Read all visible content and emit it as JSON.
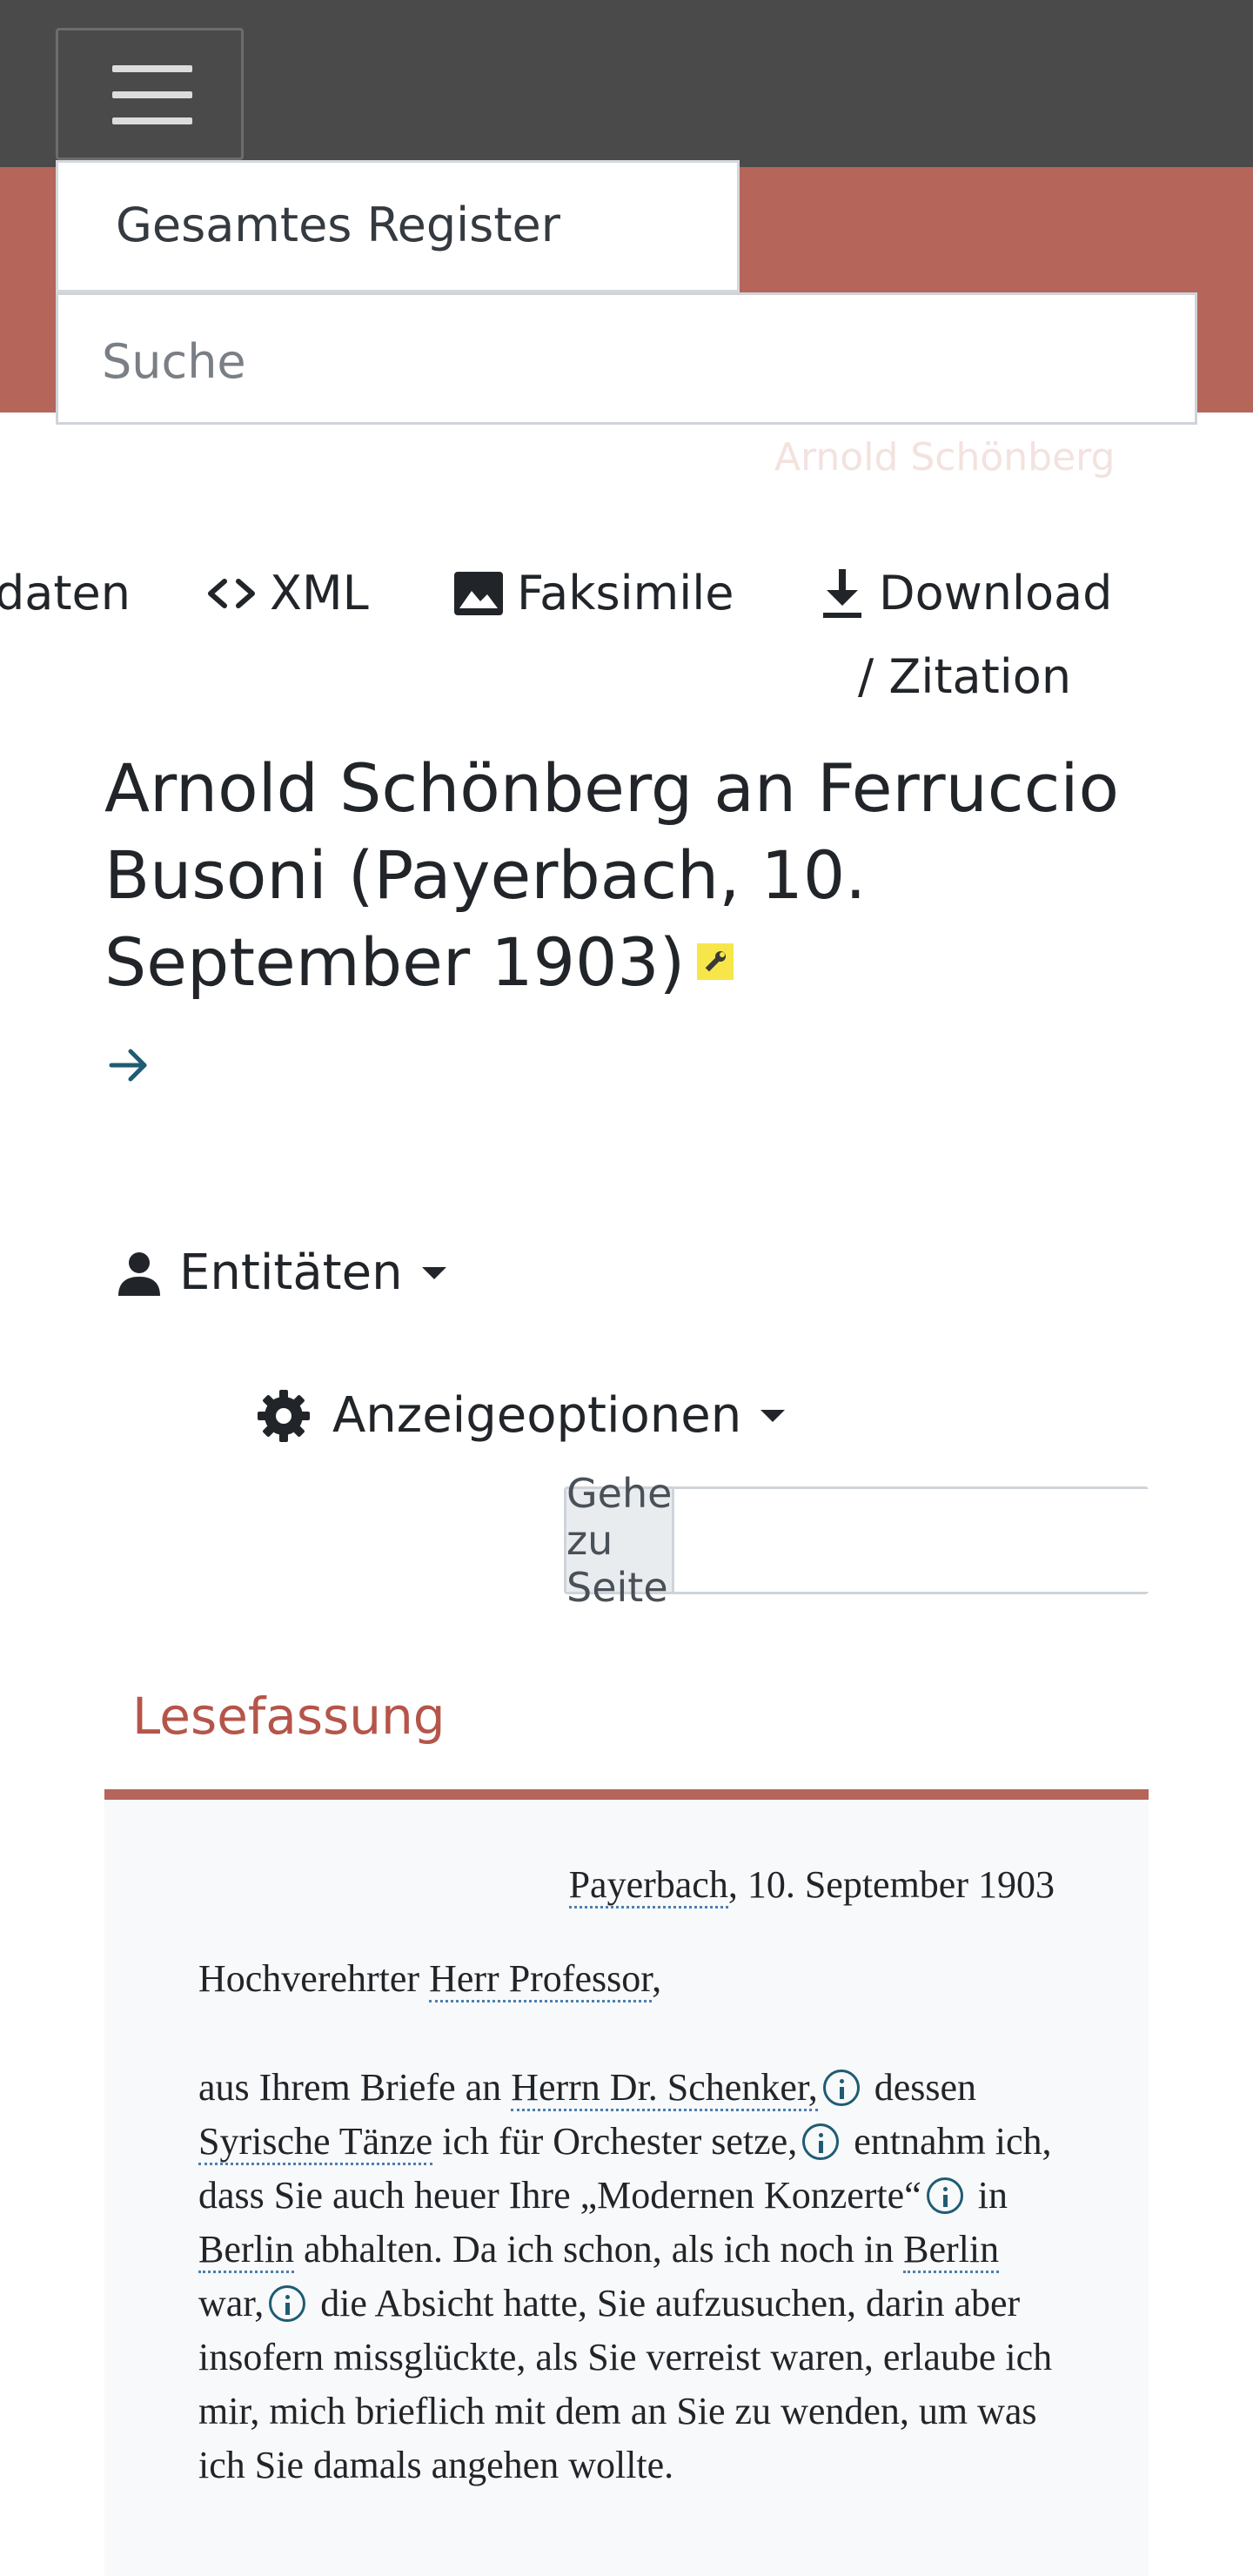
{
  "header": {
    "menu_icon": "hamburger-menu-icon",
    "register_label": "Gesamtes Register",
    "site_title": "Arnold Schönberg",
    "search_placeholder": "Suche"
  },
  "toolbar": {
    "metadata_label": "daten",
    "xml_label": "XML",
    "facsimile_label": "Faksimile",
    "download_label_line1": "Download",
    "download_label_line2": "/ Zitation"
  },
  "document": {
    "title": "Arnold Schönberg an Ferruccio Busoni (Payerbach, 10. September 1903)",
    "status_badge_icon": "wrench-icon",
    "next_icon": "arrow-right-icon"
  },
  "controls": {
    "entities_label": "Entitäten",
    "display_options_label": "Anzeigeoptionen",
    "goto_page_label": "Gehe zu Seite"
  },
  "tabs": {
    "reading_label": "Lesefassung"
  },
  "letter": {
    "place": "Payerbach",
    "date": ", 10. September 1903",
    "salutation_prefix": "Hochverehrter ",
    "salutation_entity": "Herr Professor",
    "salutation_suffix": ",",
    "p1": "aus Ihrem Briefe an ",
    "e1": "Herrn Dr. Schenker,",
    "p2": " dessen ",
    "e2": "Syrische Tänze",
    "p3": " ich für Orchester setze,",
    "p4": " entnahm ich, dass Sie auch heuer Ihre „Modernen Konzerte“",
    "p5": " in ",
    "e3": "Berlin",
    "p6": " abhalten. Da ich schon, als ich noch in ",
    "e4": "Berlin",
    "p7": " war,",
    "p8": " die Absicht hatte, Sie aufzusuchen, darin aber insofern missglückte, als Sie verreist waren, erlaube ich mir, mich brieflich mit dem an Sie zu wenden, um was ich Sie damals angehen wollte."
  },
  "colors": {
    "topbar": "#4a4a4a",
    "accent": "#b5655a",
    "tab_text": "#b5554a",
    "info_icon": "#1f5c73"
  }
}
